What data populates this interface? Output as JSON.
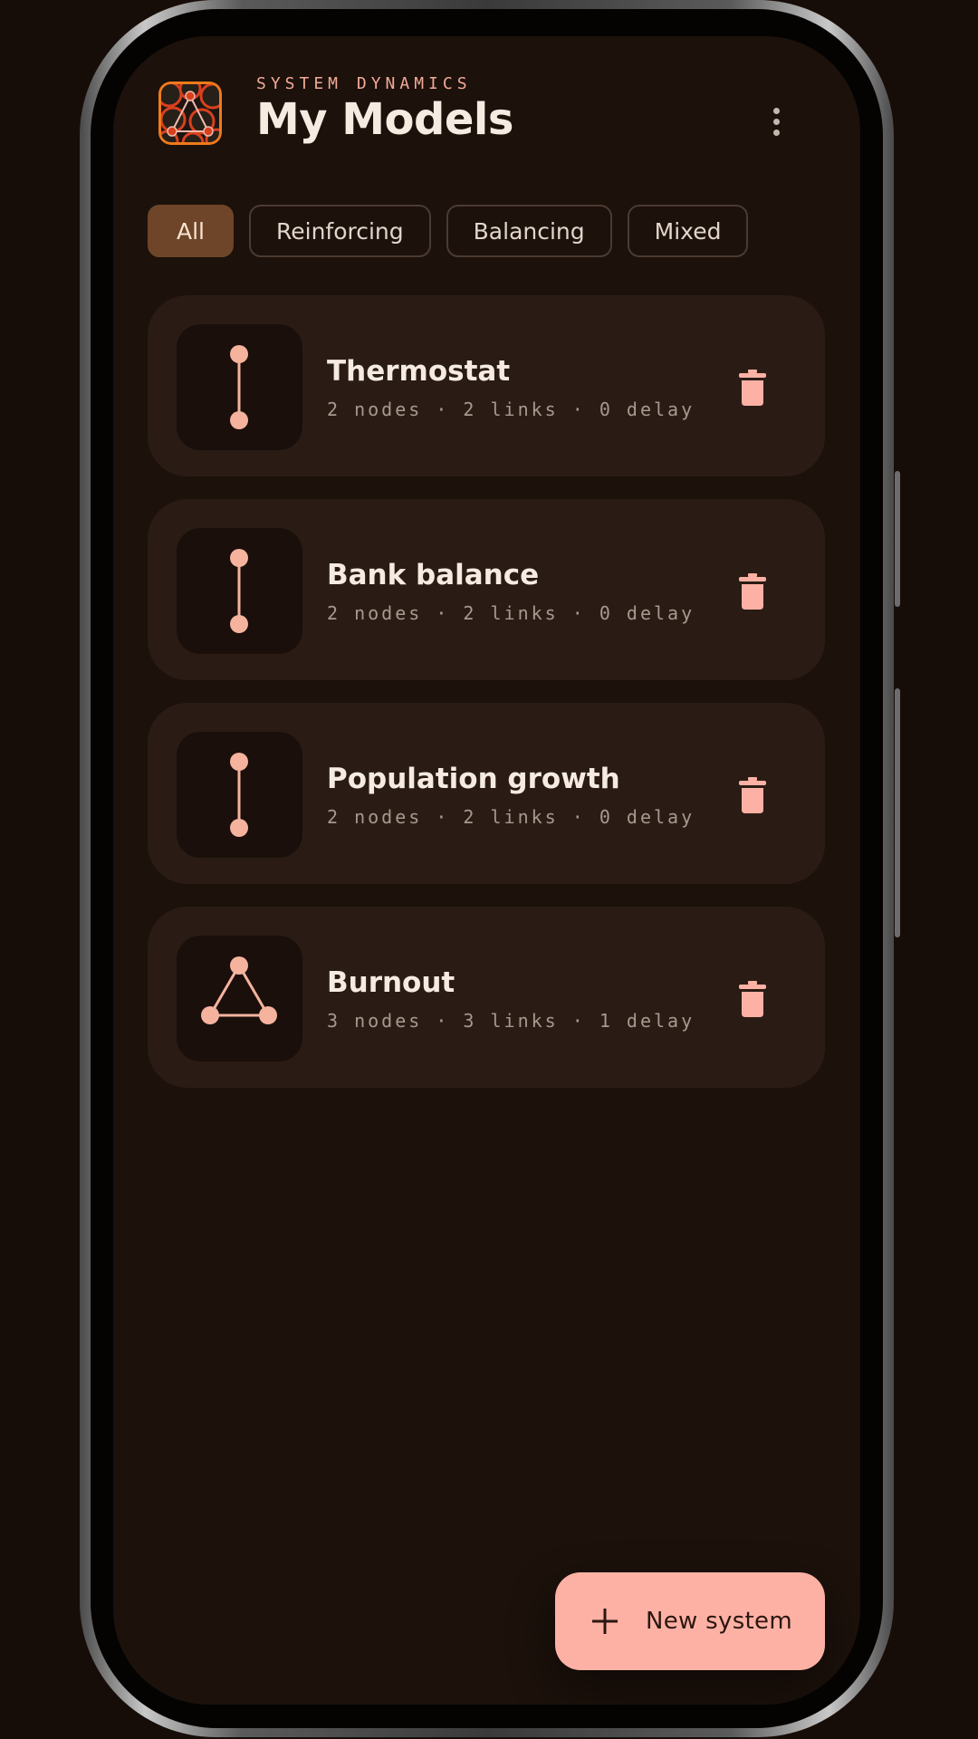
{
  "header": {
    "overline": "SYSTEM DYNAMICS",
    "title": "My Models"
  },
  "filters": [
    {
      "label": "All",
      "active": true
    },
    {
      "label": "Reinforcing",
      "active": false
    },
    {
      "label": "Balancing",
      "active": false
    },
    {
      "label": "Mixed",
      "active": false
    }
  ],
  "models": [
    {
      "name": "Thermostat",
      "meta": "2 nodes · 2 links · 0 delay",
      "thumbnail": "two-node-link-icon"
    },
    {
      "name": "Bank balance",
      "meta": "2 nodes · 2 links · 0 delay",
      "thumbnail": "two-node-link-icon"
    },
    {
      "name": "Population growth",
      "meta": "2 nodes · 2 links · 0 delay",
      "thumbnail": "two-node-link-icon"
    },
    {
      "name": "Burnout",
      "meta": "3 nodes · 3 links · 1 delay",
      "thumbnail": "three-node-triangle-icon"
    }
  ],
  "fab": {
    "label": "New system",
    "icon": "plus-icon"
  },
  "colors": {
    "background": "#1c110b",
    "card": "#2a1c15",
    "accent": "#fdb1a5",
    "active_chip": "#6e4528",
    "title_text": "#f6ebe1"
  }
}
